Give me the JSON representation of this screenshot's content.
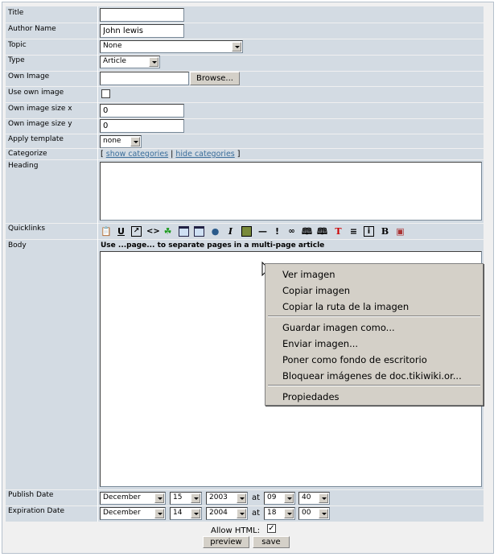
{
  "labels": {
    "title": "Title",
    "author_name": "Author Name",
    "topic": "Topic",
    "type": "Type",
    "own_image": "Own Image",
    "use_own_image": "Use own image",
    "own_image_size_x": "Own image size x",
    "own_image_size_y": "Own image size y",
    "apply_template": "Apply template",
    "categorize": "Categorize",
    "heading": "Heading",
    "quicklinks": "Quicklinks",
    "body": "Body",
    "publish_date": "Publish Date",
    "expiration_date": "Expiration Date"
  },
  "fields": {
    "title_value": "",
    "author_value": "John lewis",
    "topic_value": "None",
    "type_value": "Article",
    "own_image_value": "",
    "browse_label": "Browse...",
    "size_x_value": "0",
    "size_y_value": "0",
    "template_value": "none"
  },
  "categorize": {
    "open": "[",
    "show": "show categories",
    "pipe": "|",
    "hide": "hide categories",
    "close": "]"
  },
  "body_hint": "Use ...page... to separate pages in a multi-page article",
  "quicklink_icons": [
    "paste-icon",
    "underline-icon",
    "external-link-icon",
    "code-icon",
    "paw-icon",
    "table-icon",
    "table-alt-icon",
    "globe-icon",
    "italic-icon",
    "image-icon",
    "hr-icon",
    "exclamation-icon",
    "link-icon",
    "book-icon",
    "book-alt-icon",
    "title-icon",
    "align-icon",
    "info-icon",
    "bold-icon",
    "box-icon"
  ],
  "publish": {
    "month": "December",
    "day": "15",
    "year": "2003",
    "at": "at",
    "hour": "09",
    "minute": "40"
  },
  "expiration": {
    "month": "December",
    "day": "14",
    "year": "2004",
    "at": "at",
    "hour": "18",
    "minute": "00"
  },
  "allow_html_label": "Allow HTML:",
  "preview_label": "preview",
  "save_label": "save",
  "context_menu": {
    "items": [
      {
        "label": "Ver imagen"
      },
      {
        "label": "Copiar imagen"
      },
      {
        "label": "Copiar la ruta de la imagen"
      },
      {
        "label": "Guardar imagen como..."
      },
      {
        "label": "Enviar imagen..."
      },
      {
        "label": "Poner como fondo de escritorio"
      },
      {
        "label": "Bloquear imágenes de doc.tikiwiki.or..."
      },
      {
        "label": "Propiedades"
      }
    ]
  }
}
